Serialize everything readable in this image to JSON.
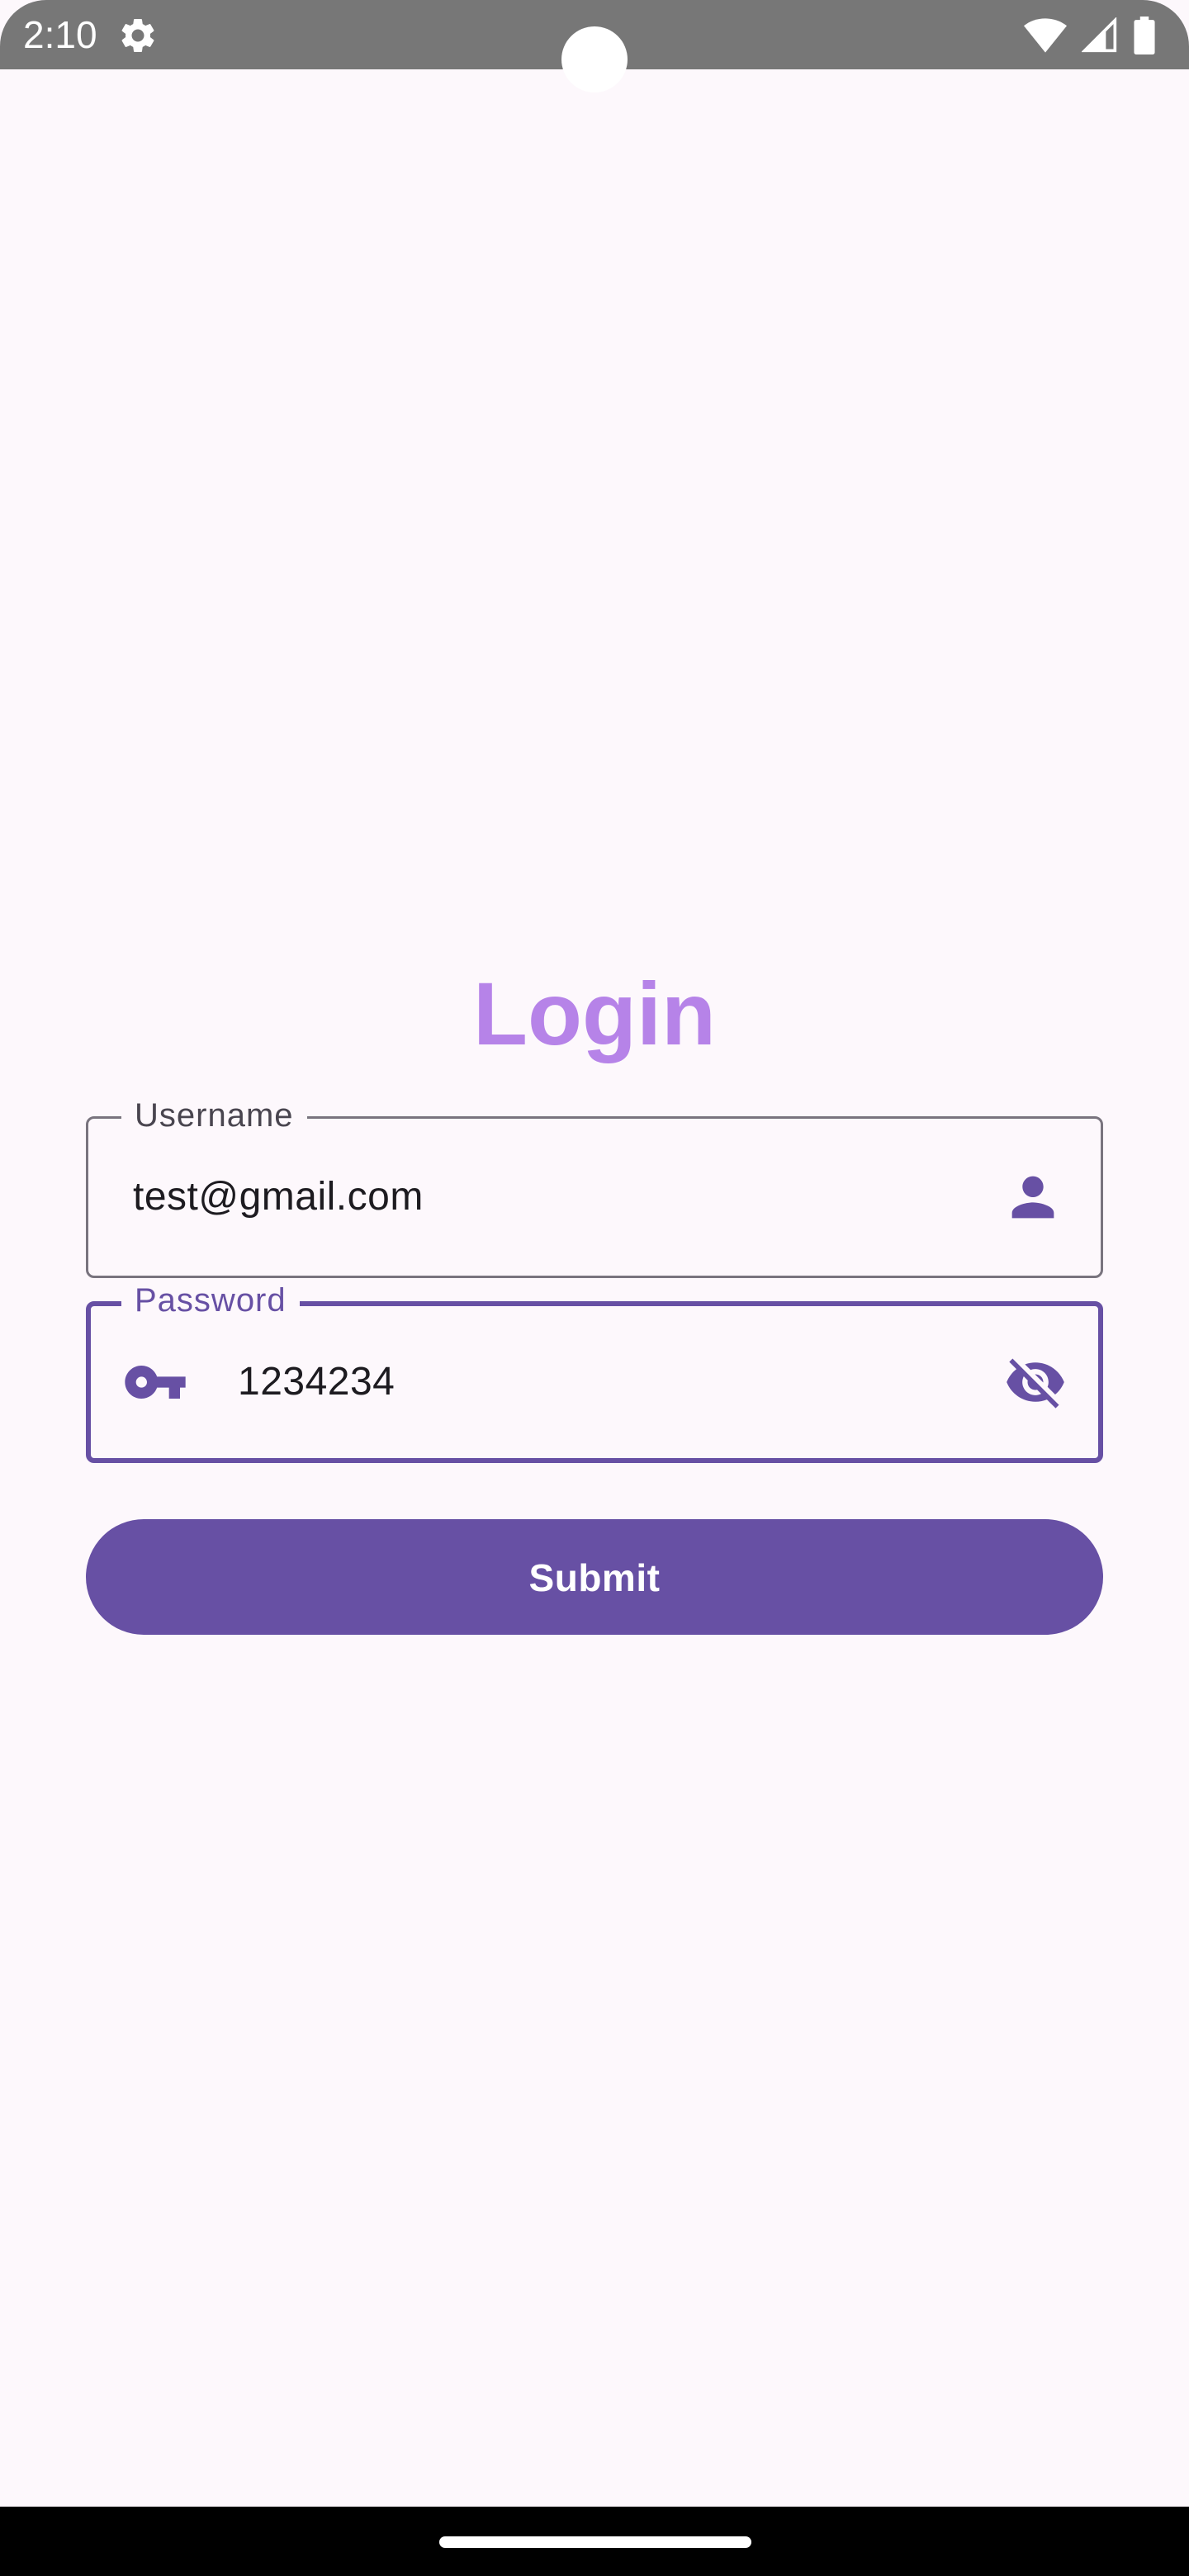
{
  "status_bar": {
    "time": "2:10",
    "icons": {
      "settings": "gear-icon",
      "wifi": "wifi-icon",
      "signal": "signal-icon",
      "battery": "battery-icon"
    }
  },
  "login": {
    "title": "Login",
    "username": {
      "label": "Username",
      "value": "test@gmail.com",
      "trailing_icon": "person-icon"
    },
    "password": {
      "label": "Password",
      "value": "1234234",
      "leading_icon": "key-icon",
      "trailing_icon": "visibility-off-icon"
    },
    "submit_label": "Submit"
  },
  "colors": {
    "title": "#b683e8",
    "primary": "#6750a4",
    "outline": "#79747e",
    "background": "#fdf8fc",
    "status_bar": "#777777",
    "nav_bar": "#000000"
  }
}
